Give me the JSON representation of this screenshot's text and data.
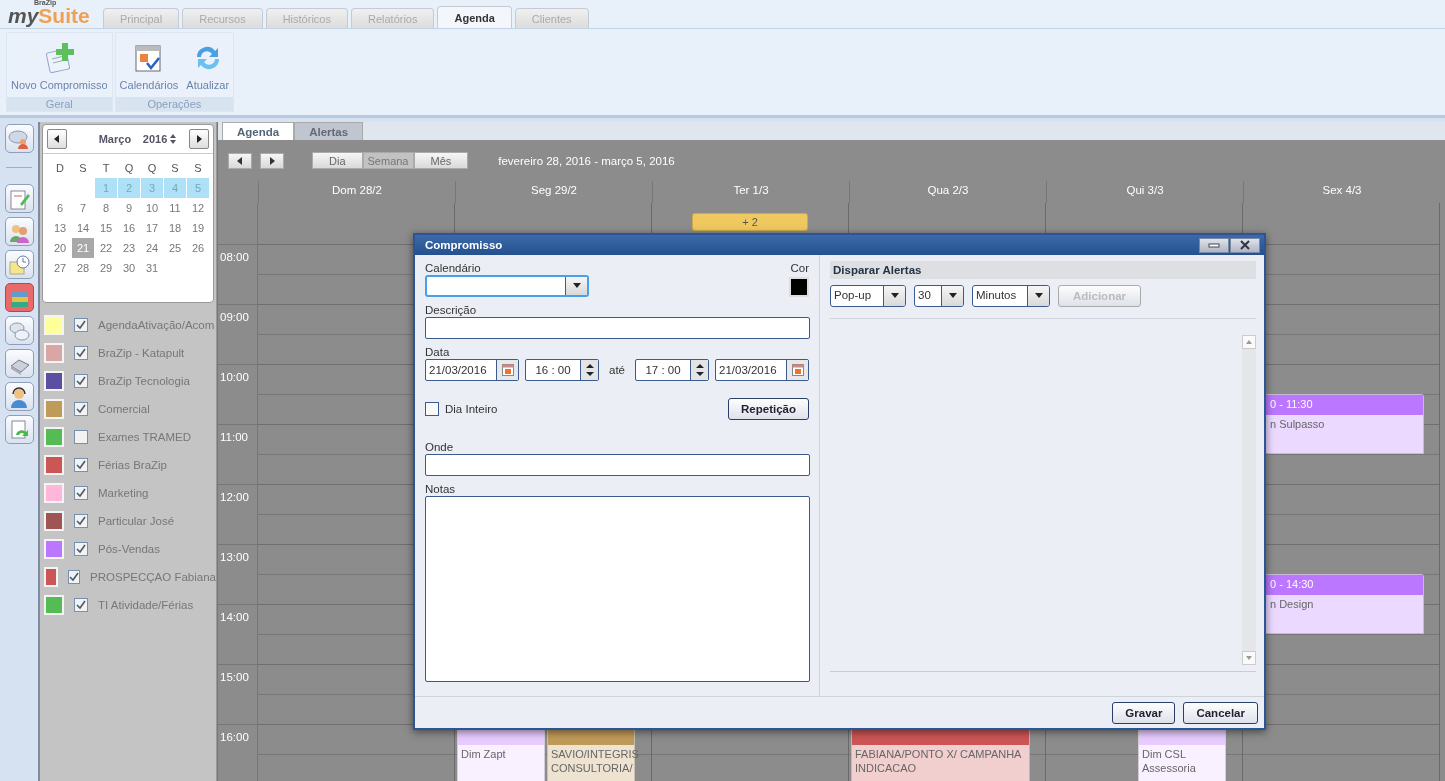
{
  "logo": {
    "tagline": "BraZip",
    "first": "my",
    "second": "Suite"
  },
  "main_tabs": [
    {
      "label": "Principal",
      "selected": false
    },
    {
      "label": "Recursos",
      "selected": false
    },
    {
      "label": "Históricos",
      "selected": false
    },
    {
      "label": "Relatórios",
      "selected": false
    },
    {
      "label": "Agenda",
      "selected": true
    },
    {
      "label": "Clientes",
      "selected": false
    }
  ],
  "ribbon_groups": [
    {
      "label": "Geral",
      "buttons": [
        {
          "label": "Novo Compromisso"
        }
      ]
    },
    {
      "label": "Operações",
      "buttons": [
        {
          "label": "Calendários"
        },
        {
          "label": "Atualizar"
        }
      ]
    }
  ],
  "side_tools": [
    {
      "selected": false
    },
    {
      "selected": false
    },
    {
      "selected": false
    },
    {
      "selected": false
    },
    {
      "selected": true
    },
    {
      "selected": false
    },
    {
      "selected": false
    },
    {
      "selected": false
    },
    {
      "selected": false
    }
  ],
  "mini_calendar": {
    "month": "Março",
    "year": "2016",
    "weekdays": [
      "D",
      "S",
      "T",
      "Q",
      "Q",
      "S",
      "S"
    ],
    "weeks": [
      [
        {
          "label": "1",
          "highlighted": true,
          "selected": false
        },
        {
          "label": "2",
          "highlighted": true,
          "selected": false
        },
        {
          "label": "3",
          "highlighted": true,
          "selected": false
        },
        {
          "label": "4",
          "highlighted": true,
          "selected": false
        },
        {
          "label": "5",
          "highlighted": true,
          "selected": false
        }
      ],
      [
        {
          "label": "6",
          "highlighted": false,
          "selected": false
        },
        {
          "label": "7",
          "highlighted": false,
          "selected": false
        },
        {
          "label": "8",
          "highlighted": false,
          "selected": false
        },
        {
          "label": "9",
          "highlighted": false,
          "selected": false
        },
        {
          "label": "10",
          "highlighted": false,
          "selected": false
        },
        {
          "label": "11",
          "highlighted": false,
          "selected": false
        },
        {
          "label": "12",
          "highlighted": false,
          "selected": false
        }
      ],
      [
        {
          "label": "13",
          "highlighted": false,
          "selected": false
        },
        {
          "label": "14",
          "highlighted": false,
          "selected": false
        },
        {
          "label": "15",
          "highlighted": false,
          "selected": false
        },
        {
          "label": "16",
          "highlighted": false,
          "selected": false
        },
        {
          "label": "17",
          "highlighted": false,
          "selected": false
        },
        {
          "label": "18",
          "highlighted": false,
          "selected": false
        },
        {
          "label": "19",
          "highlighted": false,
          "selected": false
        }
      ],
      [
        {
          "label": "20",
          "highlighted": false,
          "selected": false
        },
        {
          "label": "21",
          "highlighted": false,
          "selected": true
        },
        {
          "label": "22",
          "highlighted": false,
          "selected": false
        },
        {
          "label": "23",
          "highlighted": false,
          "selected": false
        },
        {
          "label": "24",
          "highlighted": false,
          "selected": false
        },
        {
          "label": "25",
          "highlighted": false,
          "selected": false
        },
        {
          "label": "26",
          "highlighted": false,
          "selected": false
        }
      ],
      [
        {
          "label": "27",
          "highlighted": false,
          "selected": false
        },
        {
          "label": "28",
          "highlighted": false,
          "selected": false
        },
        {
          "label": "29",
          "highlighted": false,
          "selected": false
        },
        {
          "label": "30",
          "highlighted": false,
          "selected": false
        },
        {
          "label": "31",
          "highlighted": false,
          "selected": false
        }
      ]
    ]
  },
  "calendars": [
    {
      "name": "AgendaAtivação/Acom",
      "color": "#ffff99",
      "checked": true
    },
    {
      "name": "BraZip - Katapult",
      "color": "#d9a5a5",
      "checked": true
    },
    {
      "name": "BraZip Tecnologia",
      "color": "#5a4fa0",
      "checked": true
    },
    {
      "name": "Comercial",
      "color": "#c09a58",
      "checked": true
    },
    {
      "name": "Exames TRAMED",
      "color": "#55bb55",
      "checked": false
    },
    {
      "name": "Férias BraZip",
      "color": "#cc5555",
      "checked": true
    },
    {
      "name": "Marketing",
      "color": "#ffb6d9",
      "checked": true
    },
    {
      "name": "Particular José",
      "color": "#a05555",
      "checked": true
    },
    {
      "name": "Pós-Vendas",
      "color": "#bb77ff",
      "checked": true
    },
    {
      "name": "PROSPECÇAO Fabiana",
      "color": "#cc5555",
      "checked": true
    },
    {
      "name": "TI Atividade/Férias",
      "color": "#55bb55",
      "checked": true
    }
  ],
  "view_tabs": [
    {
      "label": "Agenda",
      "selected": true
    },
    {
      "label": "Alertas",
      "selected": false
    }
  ],
  "view_modes": [
    {
      "label": "Dia",
      "selected": false
    },
    {
      "label": "Semana",
      "selected": true
    },
    {
      "label": "Mês",
      "selected": false
    }
  ],
  "date_range": "fevereiro 28, 2016 - março 5, 2016",
  "hours": [
    "08:00",
    "09:00",
    "10:00",
    "11:00",
    "12:00",
    "13:00",
    "14:00",
    "15:00",
    "16:00"
  ],
  "days": [
    {
      "label": "Dom 28/2"
    },
    {
      "label": "Seg 29/2",
      "events": [
        {
          "kind": "timed",
          "color": "#e8ccff",
          "lines": [
            "Dim Zapt"
          ]
        },
        {
          "kind": "timed",
          "color": "#c09a58",
          "lines": [
            "SAVIO/INTEGRIS",
            "CONSULTORIA/"
          ]
        }
      ]
    },
    {
      "label": "Ter 1/3",
      "events": [
        {
          "kind": "more",
          "color": "#f0c860",
          "lines": [
            "+ 2"
          ]
        }
      ]
    },
    {
      "label": "Qua 2/3",
      "events": [
        {
          "kind": "timed",
          "color": "#cc5555",
          "lines": [
            "FABIANA/PONTO X/ CAMPANHA",
            "INDICACAO"
          ]
        }
      ]
    },
    {
      "label": "Qui 3/3",
      "events": [
        {
          "kind": "timed",
          "color": "#e8ccff",
          "lines": [
            "Dim CSL",
            "Assessoria"
          ]
        }
      ]
    },
    {
      "label": "Sex 4/3",
      "events": [
        {
          "kind": "timed",
          "color": "#bb77ff",
          "title": "0 - 11:30",
          "lines": [
            "n Sulpasso"
          ]
        },
        {
          "kind": "timed",
          "color": "#bb77ff",
          "title": "0 - 14:30",
          "lines": [
            "n Design"
          ]
        }
      ]
    }
  ],
  "dialog": {
    "title": "Compromisso",
    "calendar_label": "Calendário",
    "color_label": "Cor",
    "color": "#000000",
    "description_label": "Descrição",
    "date_label": "Data",
    "start_date": "21/03/2016",
    "start_time": "16 : 00",
    "until": "até",
    "end_time": "17 : 00",
    "end_date": "21/03/2016",
    "all_day": {
      "label": "Dia Inteiro",
      "checked": false
    },
    "repeat_button": "Repetição",
    "where_label": "Onde",
    "notes_label": "Notas",
    "alerts_title": "Disparar Alertas",
    "alert_selects": [
      "Pop-up",
      "30",
      "Minutos"
    ],
    "add_button": {
      "label": "Adicionar",
      "disabled": true
    },
    "buttons": [
      "Gravar",
      "Cancelar"
    ]
  }
}
